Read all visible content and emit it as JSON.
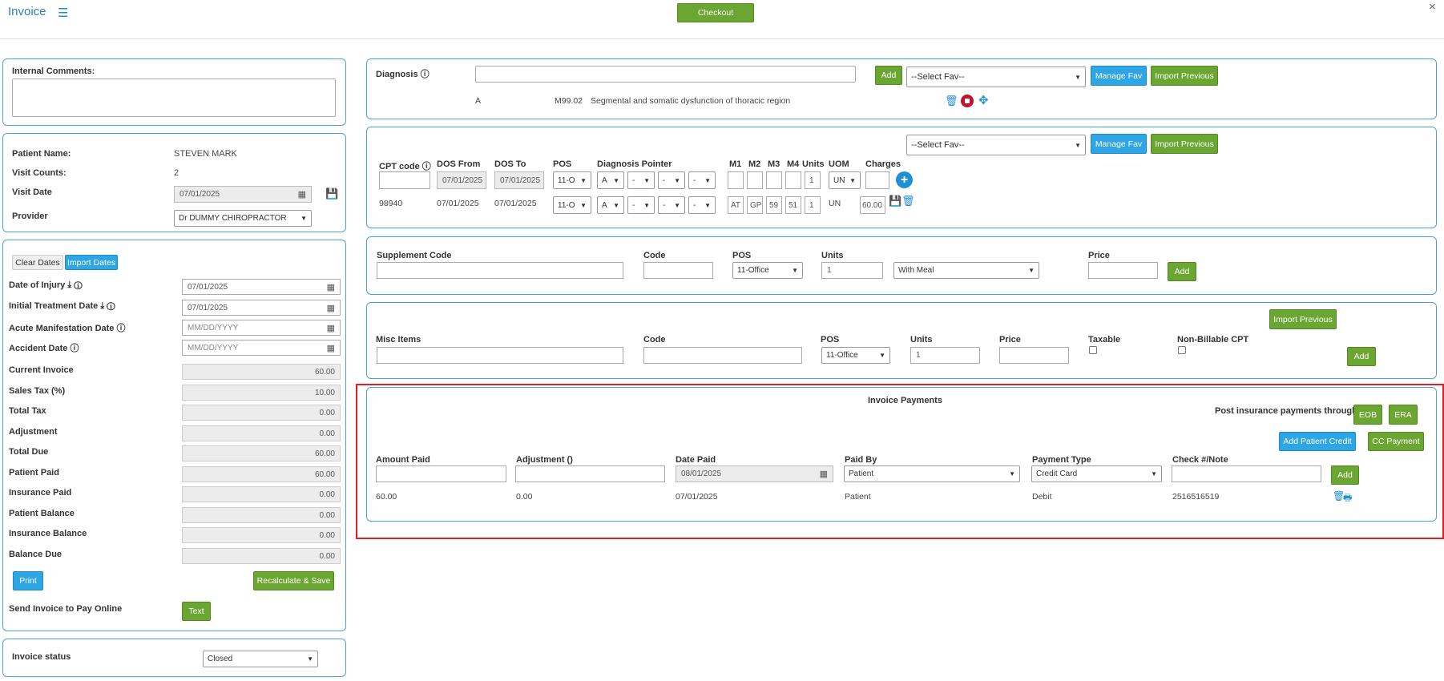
{
  "header": {
    "title": "Invoice",
    "checkout_label": "Checkout",
    "close": "×"
  },
  "comments": {
    "label": "Internal Comments:",
    "value": ""
  },
  "patient": {
    "name_label": "Patient Name:",
    "name": "STEVEN MARK",
    "visit_counts_label": "Visit Counts:",
    "visit_counts": "2",
    "visit_date_label": "Visit Date",
    "visit_date": "07/01/2025",
    "provider_label": "Provider",
    "provider": "Dr DUMMY CHIROPRACTOR"
  },
  "dates": {
    "clear_label": "Clear Dates",
    "import_label": "Import Dates",
    "injury_label": "Date of Injury",
    "injury": "07/01/2025",
    "initial_label": "Initial Treatment Date",
    "initial": "07/01/2025",
    "acute_label": "Acute Manifestation Date",
    "acute_placeholder": "MM/DD/YYYY",
    "accident_label": "Accident Date",
    "accident_placeholder": "MM/DD/YYYY"
  },
  "totals": [
    {
      "label": "Current Invoice",
      "value": "60.00"
    },
    {
      "label": "Sales Tax (%)",
      "value": "10.00"
    },
    {
      "label": "Total Tax",
      "value": "0.00"
    },
    {
      "label": "Adjustment",
      "value": "0.00"
    },
    {
      "label": "Total Due",
      "value": "60.00"
    },
    {
      "label": "Patient Paid",
      "value": "60.00"
    },
    {
      "label": "Insurance Paid",
      "value": "0.00"
    },
    {
      "label": "Patient Balance",
      "value": "0.00"
    },
    {
      "label": "Insurance Balance",
      "value": "0.00"
    },
    {
      "label": "Balance Due",
      "value": "0.00"
    }
  ],
  "actions": {
    "print": "Print",
    "recalc": "Recalculate & Save",
    "send_label": "Send Invoice to Pay Online",
    "text": "Text"
  },
  "status": {
    "label": "Invoice status",
    "value": "Closed"
  },
  "diagnosis": {
    "label": "Diagnosis",
    "input": "",
    "add": "Add",
    "fav": "--Select Fav--",
    "manage": "Manage Fav",
    "import": "Import Previous",
    "row": {
      "letter": "A",
      "code": "M99.02",
      "desc": "Segmental and somatic dysfunction of thoracic region"
    }
  },
  "cpt": {
    "fav": "--Select Fav--",
    "manage": "Manage Fav",
    "import": "Import Previous",
    "headers": {
      "cpt": "CPT code",
      "from": "DOS From",
      "to": "DOS To",
      "pos": "POS",
      "pointer": "Diagnosis Pointer",
      "m1": "M1",
      "m2": "M2",
      "m3": "M3",
      "m4": "M4",
      "units": "Units",
      "uom": "UOM",
      "charges": "Charges"
    },
    "new": {
      "from": "07/01/2025",
      "to": "07/01/2025",
      "pos": "11-O",
      "p1": "A",
      "p2": "-",
      "p3": "-",
      "p4": "-",
      "units": "1",
      "uom": "UN"
    },
    "row": {
      "code": "98940",
      "from": "07/01/2025",
      "to": "07/01/2025",
      "pos": "11-O",
      "p1": "A",
      "p2": "-",
      "p3": "-",
      "p4": "-",
      "m1": "AT",
      "m2": "GP",
      "m3": "59",
      "m4": "51",
      "units": "1",
      "uom": "UN",
      "charges": "60.00"
    }
  },
  "supplement": {
    "label": "Supplement Code",
    "code_label": "Code",
    "pos_label": "POS",
    "pos": "11-Office",
    "units_label": "Units",
    "units": "1",
    "meal": "With Meal",
    "price_label": "Price",
    "add": "Add"
  },
  "misc": {
    "import": "Import Previous",
    "label": "Misc Items",
    "code_label": "Code",
    "pos_label": "POS",
    "pos": "11-Office",
    "units_label": "Units",
    "units": "1",
    "price_label": "Price",
    "taxable_label": "Taxable",
    "nonbill_label": "Non-Billable CPT",
    "add": "Add"
  },
  "payments": {
    "title": "Invoice Payments",
    "post_label": "Post insurance payments through",
    "eob": "EOB",
    "era": "ERA",
    "add_credit": "Add Patient Credit",
    "cc": "CC Payment",
    "headers": {
      "amount": "Amount Paid",
      "adjust": "Adjustment ()",
      "date": "Date Paid",
      "by": "Paid By",
      "type": "Payment Type",
      "check": "Check #/Note"
    },
    "new": {
      "date": "08/01/2025",
      "by": "Patient",
      "type": "Credit Card",
      "add": "Add"
    },
    "row": {
      "amount": "60.00",
      "adjust": "0.00",
      "date": "07/01/2025",
      "by": "Patient",
      "type": "Debit",
      "check": "2516516519"
    }
  },
  "colors": {
    "accent": "#2ea6e6",
    "green": "#6aa631",
    "highlight": "#e02020"
  }
}
